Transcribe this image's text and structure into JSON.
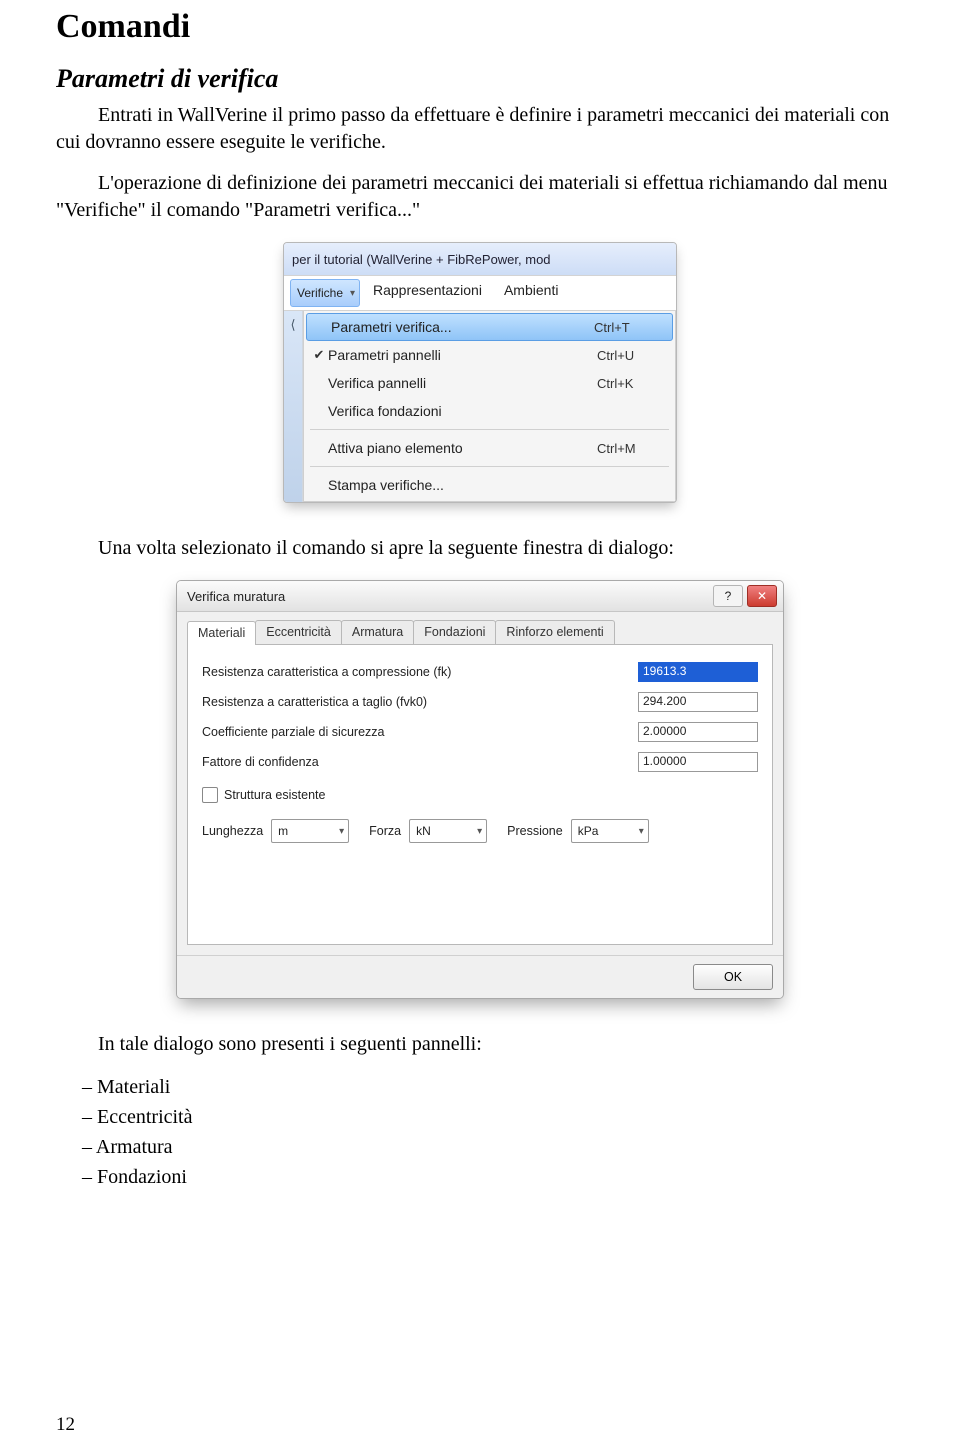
{
  "section_title": "Comandi",
  "subsection_title": "Parametri di verifica",
  "para1": "Entrati in WallVerine il primo passo da effettuare è definire i parametri meccanici dei materiali con cui dovranno essere eseguite le verifiche.",
  "para2": "L'operazione di definizione dei parametri meccanici dei materiali si effettua richiamando dal menu \"Verifiche\" il comando \"Parametri verifica...\"",
  "menu": {
    "window_caption": "per il tutorial (WallVerine + FibRePower, mod",
    "toolbar_items": [
      "Verifiche",
      "Rappresentazioni",
      "Ambienti"
    ],
    "items": [
      {
        "check": "",
        "label": "Parametri verifica...",
        "shortcut": "Ctrl+T",
        "highlighted": true
      },
      {
        "check": "✔",
        "label": "Parametri pannelli",
        "shortcut": "Ctrl+U"
      },
      {
        "check": "",
        "label": "Verifica pannelli",
        "shortcut": "Ctrl+K"
      },
      {
        "check": "",
        "label": "Verifica fondazioni",
        "shortcut": ""
      }
    ],
    "sep1_after": 3,
    "items2": [
      {
        "check": "",
        "label": "Attiva piano elemento",
        "shortcut": "Ctrl+M"
      }
    ],
    "items3": [
      {
        "check": "",
        "label": "Stampa verifiche...",
        "shortcut": ""
      }
    ]
  },
  "para3": "Una volta selezionato il comando si apre la seguente finestra di dialogo:",
  "dialog": {
    "title": "Verifica muratura",
    "help_symbol": "?",
    "close_symbol": "✕",
    "tabs": [
      "Materiali",
      "Eccentricità",
      "Armatura",
      "Fondazioni",
      "Rinforzo elementi"
    ],
    "fields": [
      {
        "label": "Resistenza caratteristica a compressione (fk)",
        "value": "19613.3",
        "highlight": true
      },
      {
        "label": "Resistenza a caratteristica a taglio (fvk0)",
        "value": "294.200",
        "highlight": false
      },
      {
        "label": "Coefficiente parziale di sicurezza",
        "value": "2.00000",
        "highlight": false
      },
      {
        "label": "Fattore di confidenza",
        "value": "1.00000",
        "highlight": false
      }
    ],
    "checkbox_label": "Struttura esistente",
    "units": {
      "lunghezza_label": "Lunghezza",
      "lunghezza_val": "m",
      "forza_label": "Forza",
      "forza_val": "kN",
      "pressione_label": "Pressione",
      "pressione_val": "kPa"
    },
    "ok_label": "OK"
  },
  "para4": "In tale dialogo sono presenti i seguenti pannelli:",
  "bullets": [
    "Materiali",
    "Eccentricità",
    "Armatura",
    "Fondazioni"
  ],
  "page_number": "12"
}
